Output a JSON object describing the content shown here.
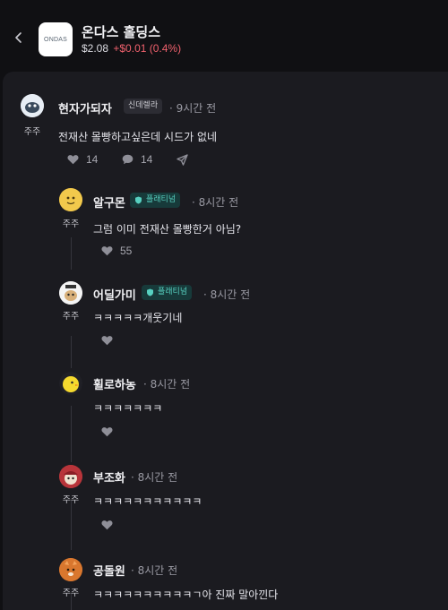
{
  "header": {
    "logo_text": "ONDAS",
    "stock_name": "온다스 홀딩스",
    "price": "$2.08",
    "change": "+$0.01 (0.4%)",
    "change_color": "#f0616d"
  },
  "comments": [
    {
      "name": "현자가되자",
      "badge": "신데렐라",
      "time": "· 9시간 전",
      "avatar_label": "주주",
      "text": "전재산 몰빵하고싶은데 시드가 없네",
      "likes": "14",
      "replies": "14"
    },
    {
      "name": "알구몬",
      "badge": "플래티넘",
      "time": "· 8시간 전",
      "avatar_label": "주주",
      "text": "그럼 이미 전재산 몰빵한거 아님?",
      "likes": "55"
    },
    {
      "name": "어딜가미",
      "badge": "플래티넘",
      "time": "· 8시간 전",
      "avatar_label": "주주",
      "text": "ㅋㅋㅋㅋㅋ개웃기네"
    },
    {
      "name": "휠로하농",
      "time": "· 8시간 전",
      "text": "ㅋㅋㅋㅋㅋㅋㅋ"
    },
    {
      "name": "부조화",
      "time": "· 8시간 전",
      "avatar_label": "주주",
      "text": "ㅋㅋㅋㅋㅋㅋㅋㅋㅋㅋㅋ"
    },
    {
      "name": "공돌원",
      "time": "· 8시간 전",
      "avatar_label": "주주",
      "text": "ㅋㅋㅋㅋㅋㅋㅋㅋㅋㅋㄱ아 진짜 말아낀다"
    }
  ]
}
